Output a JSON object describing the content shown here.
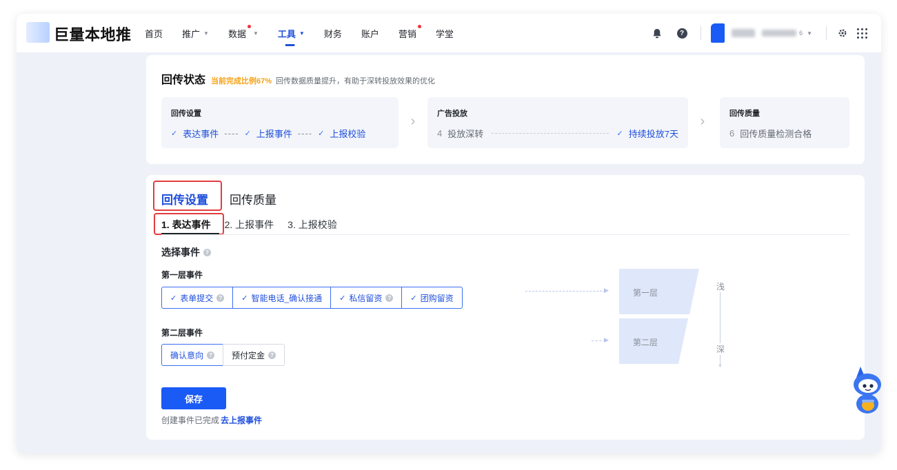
{
  "brand": {
    "name": "巨量本地推"
  },
  "nav": {
    "items": [
      {
        "label": "首页",
        "caret": false,
        "dot": false,
        "active": false
      },
      {
        "label": "推广",
        "caret": true,
        "dot": false,
        "active": false
      },
      {
        "label": "数据",
        "caret": true,
        "dot": true,
        "active": false
      },
      {
        "label": "工具",
        "caret": true,
        "dot": false,
        "active": true
      },
      {
        "label": "财务",
        "caret": false,
        "dot": false,
        "active": false
      },
      {
        "label": "账户",
        "caret": false,
        "dot": false,
        "active": false
      },
      {
        "label": "营销",
        "caret": false,
        "dot": true,
        "active": false
      },
      {
        "label": "学堂",
        "caret": false,
        "dot": false,
        "active": false
      }
    ],
    "account_suffix": "6",
    "icons": [
      "bell-icon",
      "help-icon",
      "settings-icon",
      "apps-grid-icon"
    ]
  },
  "status": {
    "title": "回传状态",
    "ratio": "当前完成比例67%",
    "desc": "回传数据质量提升，有助于深转投放效果的优化",
    "stage1": {
      "name": "回传设置",
      "step1": "表达事件",
      "step2": "上报事件",
      "step3": "上报校验",
      "sep": "----"
    },
    "stage2": {
      "name": "广告投放",
      "num": "4",
      "step1": "投放深转",
      "step2": "持续投放7天"
    },
    "stage3": {
      "name": "回传质量",
      "num": "6",
      "step1": "回传质量检测合格"
    }
  },
  "settings": {
    "tab_active": "回传设置",
    "tab_other": "回传质量",
    "subtabs": [
      "1. 表达事件",
      "2. 上报事件",
      "3. 上报校验"
    ],
    "section_title": "选择事件",
    "level1_label": "第一层事件",
    "level1_events": [
      "表单提交",
      "智能电话_确认接通",
      "私信留资",
      "团购留资"
    ],
    "level2_label": "第二层事件",
    "level2_events": [
      "确认意向",
      "预付定金"
    ],
    "save_label": "保存",
    "hint_text": "创建事件已完成",
    "hint_link": "去上报事件"
  },
  "funnel": {
    "layer1": "第一层",
    "layer2": "第二层",
    "shallow": "浅",
    "deep": "深"
  },
  "colors": {
    "primary": "#1a5af5",
    "accent_text": "#1f4fdc",
    "warning": "#f5a117",
    "highlight_box": "#e23c3c",
    "page_bg": "#eef1f8"
  }
}
